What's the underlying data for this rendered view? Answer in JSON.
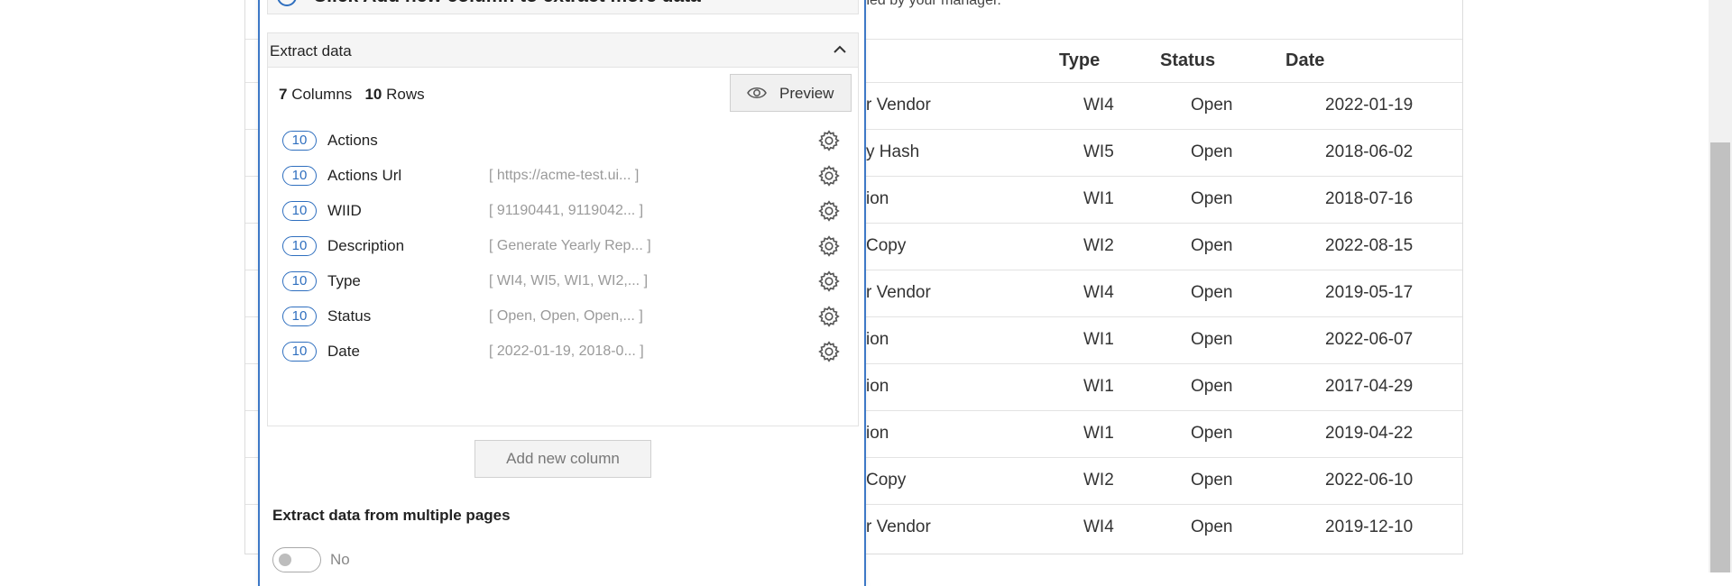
{
  "background": {
    "subtitle": "...illed by your manager.",
    "table_headers": {
      "type": "Type",
      "status": "Status",
      "date": "Date"
    },
    "rows": [
      {
        "desc": "r Vendor",
        "type": "WI4",
        "status": "Open",
        "date": "2022-01-19"
      },
      {
        "desc": "y Hash",
        "type": "WI5",
        "status": "Open",
        "date": "2018-06-02"
      },
      {
        "desc": "ion",
        "type": "WI1",
        "status": "Open",
        "date": "2018-07-16"
      },
      {
        "desc": "Copy",
        "type": "WI2",
        "status": "Open",
        "date": "2022-08-15"
      },
      {
        "desc": "r Vendor",
        "type": "WI4",
        "status": "Open",
        "date": "2019-05-17"
      },
      {
        "desc": "ion",
        "type": "WI1",
        "status": "Open",
        "date": "2022-06-07"
      },
      {
        "desc": "ion",
        "type": "WI1",
        "status": "Open",
        "date": "2017-04-29"
      },
      {
        "desc": "ion",
        "type": "WI1",
        "status": "Open",
        "date": "2019-04-22"
      },
      {
        "desc": "Copy",
        "type": "WI2",
        "status": "Open",
        "date": "2022-06-10"
      },
      {
        "desc": "r Vendor",
        "type": "WI4",
        "status": "Open",
        "date": "2019-12-10"
      }
    ]
  },
  "panel": {
    "info_banner": "Click Add new column to extract more data",
    "info_icon": "info-circle-icon",
    "extract_title": "Extract data",
    "collapse_icon": "chevron-up-icon",
    "columns_count": "7",
    "columns_label": "Columns",
    "rows_count": "10",
    "rows_label": "Rows",
    "preview_label": "Preview",
    "preview_icon": "eye-icon",
    "columns": [
      {
        "count": "10",
        "name": "Actions",
        "sample": ""
      },
      {
        "count": "10",
        "name": "Actions Url",
        "sample": "[ https://acme-test.ui... ]"
      },
      {
        "count": "10",
        "name": "WIID",
        "sample": "[ 91190441, 9119042... ]"
      },
      {
        "count": "10",
        "name": "Description",
        "sample": "[ Generate Yearly Rep... ]"
      },
      {
        "count": "10",
        "name": "Type",
        "sample": "[ WI4, WI5, WI1, WI2,... ]"
      },
      {
        "count": "10",
        "name": "Status",
        "sample": "[ Open, Open, Open,... ]"
      },
      {
        "count": "10",
        "name": "Date",
        "sample": "[ 2022-01-19, 2018-0... ]"
      }
    ],
    "add_column_label": "Add new column",
    "multi_pages_label": "Extract data from multiple pages",
    "multi_pages_value": "No"
  },
  "colors": {
    "accent": "#2f6fbf",
    "panel_border": "#3d78c6",
    "muted_text": "#9a9a9a"
  }
}
